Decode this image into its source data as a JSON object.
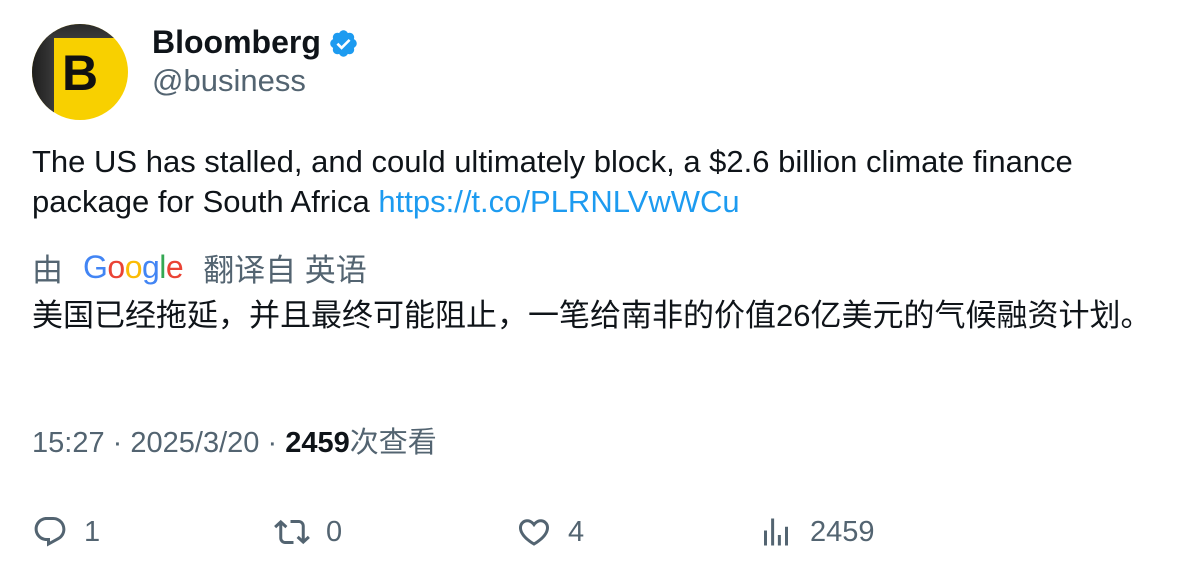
{
  "account": {
    "name": "Bloomberg",
    "handle": "@business",
    "avatar_letter": "B",
    "verified": true
  },
  "tweet": {
    "text": "The US has stalled, and could ultimately block, a $2.6 billion climate finance package for South Africa",
    "link": "https://t.co/PLRNLVwWCu"
  },
  "translation": {
    "prefix": "由",
    "google_letters": [
      "G",
      "o",
      "o",
      "g",
      "l",
      "e"
    ],
    "google_colors": [
      "#4285f4",
      "#ea4335",
      "#fbbc05",
      "#4285f4",
      "#34a853",
      "#ea4335"
    ],
    "suffix": "翻译自 英语",
    "text": "美国已经拖延，并且最终可能阻止，一笔给南非的价值26亿美元的气候融资计划。"
  },
  "meta": {
    "time": "15:27",
    "separator": "·",
    "date": "2025/3/20",
    "views_count": "2459",
    "views_label": "次查看"
  },
  "actions": {
    "reply_count": "1",
    "retweet_count": "0",
    "like_count": "4",
    "views_count": "2459"
  },
  "colors": {
    "link": "#1d9bf0",
    "secondary_text": "#536471",
    "primary_text": "#0f1419",
    "verified": "#1d9bf0",
    "avatar_bg": "#f8d000"
  },
  "icons": {
    "reply": "reply-icon",
    "retweet": "retweet-icon",
    "like": "heart-icon",
    "views": "bar-chart-icon",
    "verified": "verified-badge-icon"
  }
}
